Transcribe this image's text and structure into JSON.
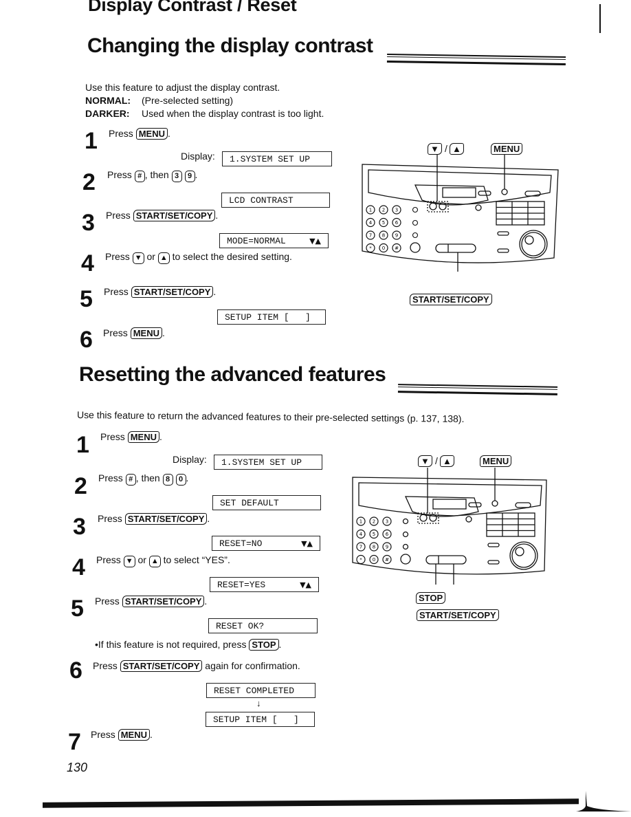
{
  "page": {
    "header_title": "Display Contrast / Reset",
    "page_number": "130"
  },
  "section1": {
    "title": "Changing the display contrast",
    "intro_line": "Use this feature to adjust the display contrast.",
    "options": [
      {
        "label": "NORMAL:",
        "text": "(Pre-selected setting)"
      },
      {
        "label": "DARKER:",
        "text": "Used when the display contrast is too light."
      }
    ],
    "display_label": "Display:",
    "steps": [
      {
        "num": "1",
        "prefix": "Press",
        "keys": [
          "MENU"
        ],
        "suffix": "."
      },
      {
        "num": "2",
        "prefix": "Press",
        "keys": [
          "#"
        ],
        "mid": ", then",
        "keys2": [
          "3",
          "9"
        ],
        "suffix": "."
      },
      {
        "num": "3",
        "prefix": "Press",
        "keys": [
          "START/SET/COPY"
        ],
        "suffix": "."
      },
      {
        "num": "4",
        "prefix": "Press",
        "key_down": "▼",
        "or": "or",
        "key_up": "▲",
        "suffix": "to select the desired setting."
      },
      {
        "num": "5",
        "prefix": "Press",
        "keys": [
          "START/SET/COPY"
        ],
        "suffix": "."
      },
      {
        "num": "6",
        "prefix": "Press",
        "keys": [
          "MENU"
        ],
        "suffix": "."
      }
    ],
    "lcd": [
      {
        "text": "1.SYSTEM SET UP",
        "arrows": ""
      },
      {
        "text": "LCD CONTRAST",
        "arrows": ""
      },
      {
        "text": "MODE=NORMAL",
        "arrows": "▼▲"
      },
      {
        "text": "SETUP ITEM [   ]",
        "arrows": ""
      }
    ],
    "diagram": {
      "arrows_label_down": "▼",
      "arrows_sep": "/",
      "arrows_label_up": "▲",
      "menu_label": "MENU",
      "start_label": "START/SET/COPY"
    }
  },
  "section2": {
    "title": "Resetting the advanced features",
    "intro_line": "Use this feature to return the advanced features to their pre-selected settings (p. 137, 138).",
    "display_label": "Display:",
    "steps": [
      {
        "num": "1",
        "prefix": "Press",
        "keys": [
          "MENU"
        ],
        "suffix": "."
      },
      {
        "num": "2",
        "prefix": "Press",
        "keys": [
          "#"
        ],
        "mid": ", then",
        "keys2": [
          "8",
          "0"
        ],
        "suffix": "."
      },
      {
        "num": "3",
        "prefix": "Press",
        "keys": [
          "START/SET/COPY"
        ],
        "suffix": "."
      },
      {
        "num": "4",
        "prefix": "Press",
        "key_down": "▼",
        "or": "or",
        "key_up": "▲",
        "suffix": "to select “YES”."
      },
      {
        "num": "5",
        "prefix": "Press",
        "keys": [
          "START/SET/COPY"
        ],
        "suffix": "."
      },
      {
        "num": "6",
        "prefix": "Press",
        "keys": [
          "START/SET/COPY"
        ],
        "suffix": "again for confirmation."
      },
      {
        "num": "7",
        "prefix": "Press",
        "keys": [
          "MENU"
        ],
        "suffix": "."
      }
    ],
    "note": {
      "bullet": "•",
      "text": "If this feature is not required, press",
      "key": "STOP",
      "suffix": "."
    },
    "lcd": [
      {
        "text": "1.SYSTEM SET UP",
        "arrows": ""
      },
      {
        "text": "SET DEFAULT",
        "arrows": ""
      },
      {
        "text": "RESET=NO",
        "arrows": "▼▲"
      },
      {
        "text": "RESET=YES",
        "arrows": "▼▲"
      },
      {
        "text": "RESET OK?",
        "arrows": ""
      },
      {
        "text": "RESET COMPLETED",
        "arrows": ""
      },
      {
        "text": "SETUP ITEM [   ]",
        "arrows": ""
      }
    ],
    "flow_arrow": "↓",
    "diagram": {
      "arrows_label_down": "▼",
      "arrows_sep": "/",
      "arrows_label_up": "▲",
      "menu_label": "MENU",
      "stop_label": "STOP",
      "start_label": "START/SET/COPY"
    }
  },
  "keypad": [
    "1",
    "2",
    "3",
    "4",
    "5",
    "6",
    "7",
    "8",
    "9",
    "*",
    "0",
    "#"
  ]
}
